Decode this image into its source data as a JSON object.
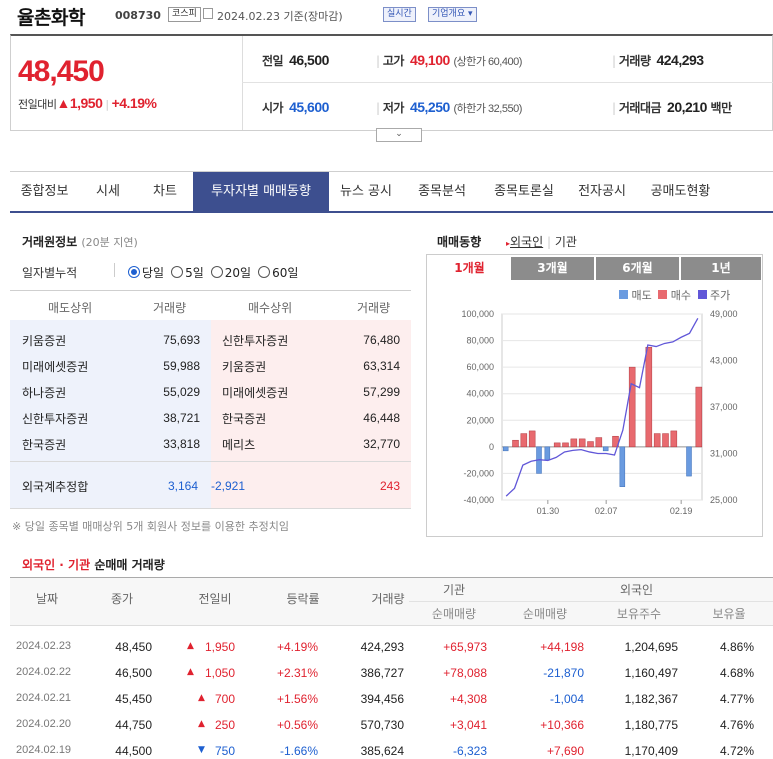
{
  "header": {
    "name": "율촌화학",
    "code": "008730",
    "market": "코스피",
    "date": "2024.02.23 기준(장마감)",
    "realtime_label": "실시간",
    "company_label": "기업개요 ▾"
  },
  "price": {
    "current": "48,450",
    "change_label": "전일대비",
    "change_amount": "▲1,950",
    "change_rate": "+4.19%",
    "prev_label": "전일",
    "prev": "46,500",
    "high_label": "고가",
    "high": "49,100",
    "upper_limit": "(상한가 60,400)",
    "volume_label": "거래량",
    "volume": "424,293",
    "open_label": "시가",
    "open": "45,600",
    "low_label": "저가",
    "low": "45,250",
    "lower_limit": "(하한가 32,550)",
    "amount_label": "거래대금",
    "amount": "20,210",
    "amount_unit": "백만"
  },
  "tabs": [
    "종합정보",
    "시세",
    "차트",
    "투자자별 매매동향",
    "뉴스 공시",
    "종목분석",
    "종목토론실",
    "전자공시",
    "공매도현황"
  ],
  "broker": {
    "title": "거래원정보",
    "delay": "(20분 지연)",
    "period_label": "일자별누적",
    "options": [
      "당일",
      "5일",
      "20일",
      "60일"
    ],
    "headers": [
      "매도상위",
      "거래량",
      "매수상위",
      "거래량"
    ],
    "rows": [
      [
        "키움증권",
        "75,693",
        "신한투자증권",
        "76,480"
      ],
      [
        "미래에셋증권",
        "59,988",
        "키움증권",
        "63,314"
      ],
      [
        "하나증권",
        "55,029",
        "미래에셋증권",
        "57,299"
      ],
      [
        "신한투자증권",
        "38,721",
        "한국증권",
        "46,448"
      ],
      [
        "한국증권",
        "33,818",
        "메리츠",
        "32,770"
      ]
    ],
    "foreign_label": "외국계추정합",
    "foreign_sell": "3,164",
    "foreign_net": "-2,921",
    "foreign_buy": "243",
    "note": "※ 당일 종목별 매매상위 5개 회원사 정보를 이용한 추정치임"
  },
  "trend": {
    "title": "매매동향",
    "foreign_link": "외국인",
    "inst_link": "기관",
    "periods": [
      "1개월",
      "3개월",
      "6개월",
      "1년"
    ],
    "legend": [
      "매도",
      "매수",
      "주가"
    ]
  },
  "chart_data": {
    "type": "bar",
    "series": [
      {
        "name": "매도",
        "values": [
          -3000,
          0,
          0,
          0,
          -20000,
          -10000,
          0,
          0,
          0,
          0,
          0,
          0,
          -3000,
          0,
          -30000,
          0,
          0,
          0,
          0,
          0,
          0,
          0,
          -22000,
          0
        ]
      },
      {
        "name": "매수",
        "values": [
          0,
          5000,
          10000,
          12000,
          0,
          0,
          3000,
          3000,
          6000,
          6000,
          4000,
          7000,
          0,
          8000,
          0,
          60000,
          0,
          75000,
          10000,
          10000,
          12000,
          0,
          0,
          45000
        ]
      },
      {
        "name": "주가",
        "values": [
          25500,
          26500,
          29500,
          30000,
          30200,
          30100,
          30500,
          31200,
          31400,
          31500,
          31200,
          31000,
          31000,
          30800,
          34000,
          40000,
          39500,
          45000,
          44800,
          45200,
          45400,
          46000,
          46500,
          48450
        ]
      }
    ],
    "yticks_left": [
      "100,000",
      "80,000",
      "60,000",
      "40,000",
      "20,000",
      "0",
      "-20,000",
      "-40,000"
    ],
    "yticks_right": [
      "49,000",
      "43,000",
      "37,000",
      "31,000",
      "25,000"
    ],
    "xticks": [
      "01.30",
      "02.07",
      "02.19"
    ],
    "ylim_left": [
      -40000,
      100000
    ],
    "ylim_right": [
      25000,
      49000
    ],
    "colors": {
      "sell": "#6a9be0",
      "buy": "#e86a6f",
      "price": "#6157d8"
    }
  },
  "net": {
    "title_red": "외국인 · 기관",
    "title": "순매매 거래량",
    "headers": [
      "날짜",
      "종가",
      "전일비",
      "등락률",
      "거래량",
      "기관",
      "외국인"
    ],
    "subheaders": [
      "순매매량",
      "순매매량",
      "보유주수",
      "보유율"
    ],
    "rows": [
      {
        "date": "2024.02.23",
        "close": "48,450",
        "dir": "▲",
        "diff": "1,950",
        "rate": "+4.19%",
        "vol": "424,293",
        "inst": "+65,973",
        "foreign": "+44,198",
        "hold": "1,204,695",
        "ratio": "4.86%",
        "up": true,
        "fup": true,
        "iup": true
      },
      {
        "date": "2024.02.22",
        "close": "46,500",
        "dir": "▲",
        "diff": "1,050",
        "rate": "+2.31%",
        "vol": "386,727",
        "inst": "+78,088",
        "foreign": "-21,870",
        "hold": "1,160,497",
        "ratio": "4.68%",
        "up": true,
        "fup": false,
        "iup": true
      },
      {
        "date": "2024.02.21",
        "close": "45,450",
        "dir": "▲",
        "diff": "700",
        "rate": "+1.56%",
        "vol": "394,456",
        "inst": "+4,308",
        "foreign": "-1,004",
        "hold": "1,182,367",
        "ratio": "4.77%",
        "up": true,
        "fup": false,
        "iup": true
      },
      {
        "date": "2024.02.20",
        "close": "44,750",
        "dir": "▲",
        "diff": "250",
        "rate": "+0.56%",
        "vol": "570,730",
        "inst": "+3,041",
        "foreign": "+10,366",
        "hold": "1,180,775",
        "ratio": "4.76%",
        "up": true,
        "fup": true,
        "iup": true
      },
      {
        "date": "2024.02.19",
        "close": "44,500",
        "dir": "▼",
        "diff": "750",
        "rate": "-1.66%",
        "vol": "385,624",
        "inst": "-6,323",
        "foreign": "+7,690",
        "hold": "1,170,409",
        "ratio": "4.72%",
        "up": false,
        "fup": true,
        "iup": false
      }
    ]
  }
}
